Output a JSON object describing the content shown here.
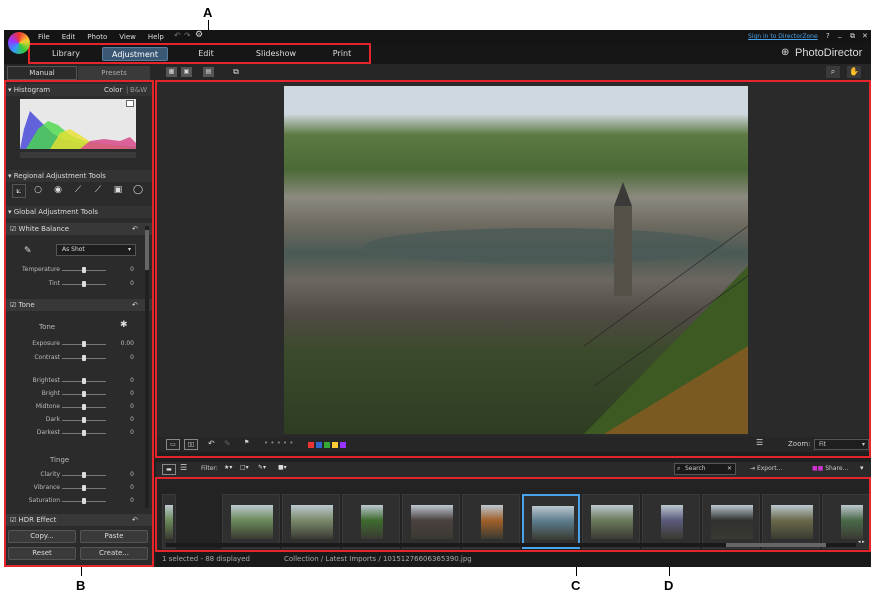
{
  "callouts": {
    "a": "A",
    "b": "B",
    "c": "C",
    "d": "D"
  },
  "menu": [
    "File",
    "Edit",
    "Photo",
    "View",
    "Help"
  ],
  "sign_in": "Sign in to DirectorZone",
  "window_controls": [
    "?",
    "_",
    "⧉",
    "✕"
  ],
  "brand": "PhotoDirector",
  "modes": [
    "Library",
    "Adjustment",
    "Edit",
    "Slideshow",
    "Print"
  ],
  "active_mode": "Adjustment",
  "panel_tabs": [
    "Manual",
    "Presets"
  ],
  "histogram": {
    "title": "Histogram",
    "color_label": "Color",
    "bw_label": "B&W"
  },
  "regional_title": "Regional Adjustment Tools",
  "global_title": "Global Adjustment Tools",
  "white_balance": {
    "title": "White Balance",
    "preset": "As Shot",
    "sliders": [
      {
        "label": "Temperature",
        "value": "0",
        "pos": 0.5
      },
      {
        "label": "Tint",
        "value": "0",
        "pos": 0.5
      }
    ]
  },
  "tone": {
    "title": "Tone",
    "sub": "Tone",
    "sliders": [
      {
        "label": "Exposure",
        "value": "0.00",
        "pos": 0.5
      },
      {
        "label": "Contrast",
        "value": "0",
        "pos": 0.5
      }
    ],
    "sliders2": [
      {
        "label": "Brightest",
        "value": "0",
        "pos": 0.5
      },
      {
        "label": "Bright",
        "value": "0",
        "pos": 0.5
      },
      {
        "label": "Midtone",
        "value": "0",
        "pos": 0.5
      },
      {
        "label": "Dark",
        "value": "0",
        "pos": 0.5
      },
      {
        "label": "Darkest",
        "value": "0",
        "pos": 0.5
      }
    ],
    "tinge": "Tinge",
    "sliders3": [
      {
        "label": "Clarity",
        "value": "0",
        "pos": 0.5
      },
      {
        "label": "Vibrance",
        "value": "0",
        "pos": 0.5
      },
      {
        "label": "Saturation",
        "value": "0",
        "pos": 0.5
      }
    ]
  },
  "hdr_title": "HDR Effect",
  "buttons": {
    "copy": "Copy...",
    "paste": "Paste",
    "reset": "Reset",
    "create": "Create..."
  },
  "zoom": {
    "label": "Zoom:",
    "value": "Fit"
  },
  "filmstrip": {
    "filter_label": "Filter:",
    "search_placeholder": "Search",
    "export": "Export...",
    "share": "Share..."
  },
  "status": {
    "selection": "1 selected - 88 displayed",
    "path": "Collection / Latest Imports / 10151276606365390.jpg"
  },
  "colors": {
    "accent": "#3a5774",
    "callout_red": "#e5252b",
    "selected_thumb": "#4aa3e8"
  },
  "thumbnail_palette": [
    "#6b8a5a",
    "#7a8a6a",
    "#3f6a2e",
    "#4a4040",
    "#a0602a",
    "#5a7a8a",
    "#6a7a5a",
    "#5a5a7a",
    "#303030",
    "#6a6a4a",
    "#4a6a4a"
  ]
}
